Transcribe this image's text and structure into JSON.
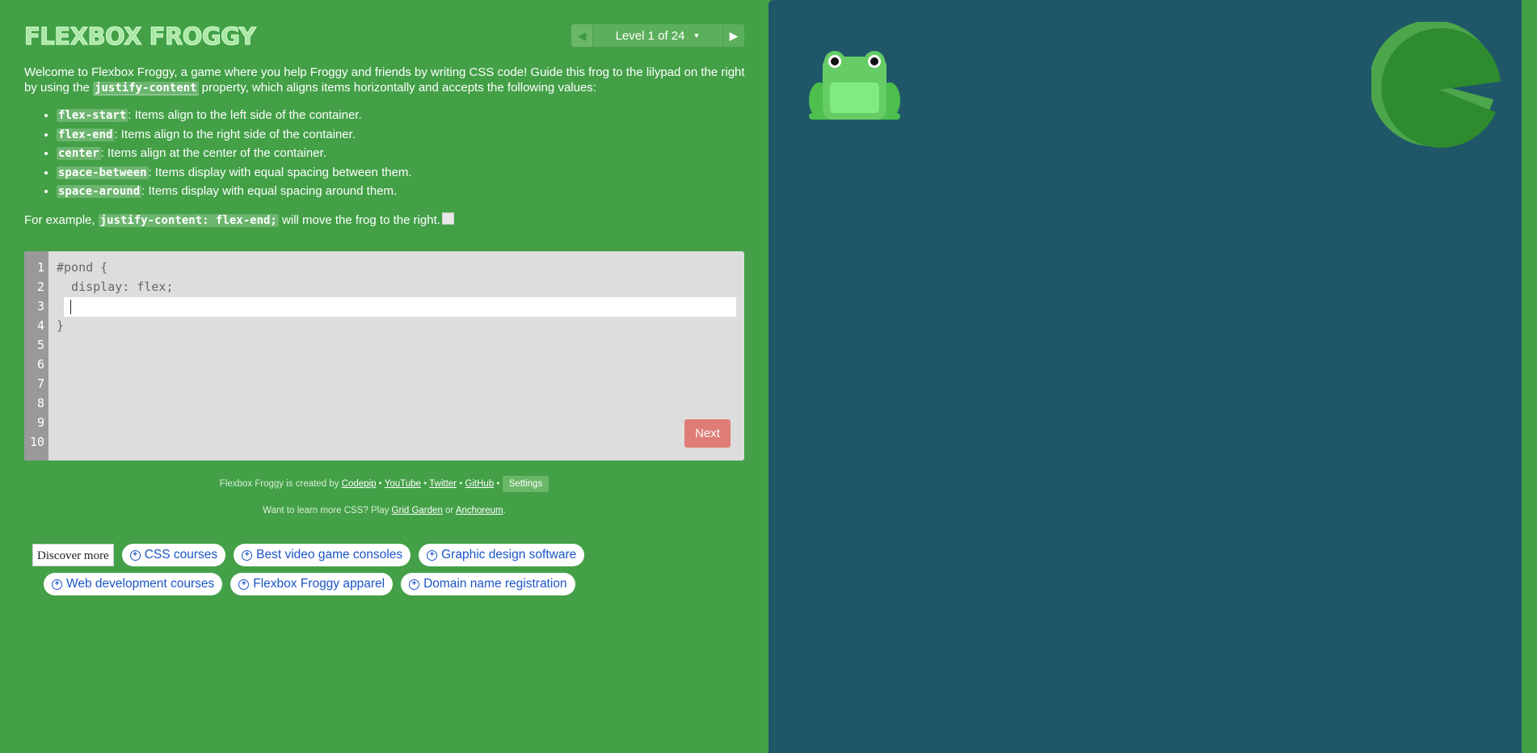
{
  "game": {
    "title": "Flexbox Froggy",
    "level": {
      "prev_icon": "triangle-left-icon",
      "label": "Level 1 of 24",
      "dropdown_icon": "caret-down-icon",
      "next_icon": "triangle-right-icon"
    }
  },
  "instructions": {
    "intro_part1": "Welcome to Flexbox Froggy, a game where you help Froggy and friends by writing CSS code! Guide this frog to the lilypad on the right by using the ",
    "intro_property": "justify-content",
    "intro_part2": " property, which aligns items horizontally and accepts the following values:",
    "values": [
      {
        "code": "flex-start",
        "description": ": Items align to the left side of the container."
      },
      {
        "code": "flex-end",
        "description": ": Items align to the right side of the container."
      },
      {
        "code": "center",
        "description": ": Items align at the center of the container."
      },
      {
        "code": "space-between",
        "description": ": Items display with equal spacing between them."
      },
      {
        "code": "space-around",
        "description": ": Items display with equal spacing around them."
      }
    ],
    "example_prefix": "For example, ",
    "example_code": "justify-content: flex-end;",
    "example_suffix": " will move the frog to the right."
  },
  "editor": {
    "line_numbers": [
      "1",
      "2",
      "3",
      "4",
      "5",
      "6",
      "7",
      "8",
      "9",
      "10"
    ],
    "line1": "#pond {",
    "line2": "  display: flex;",
    "input_value": "",
    "line4": "}",
    "next_label": "Next"
  },
  "footer": {
    "created_by": "Flexbox Froggy is created by ",
    "codepip": "Codepip",
    "sep": " • ",
    "youtube": "YouTube",
    "twitter": "Twitter",
    "github": "GitHub",
    "settings": "Settings",
    "learn_prefix": "Want to learn more CSS? Play ",
    "grid_garden": "Grid Garden",
    "or": " or ",
    "anchoreum": "Anchoreum",
    "period": "."
  },
  "discover": {
    "label": "Discover more",
    "row1": [
      "CSS courses",
      "Best video game consoles",
      "Graphic design software"
    ],
    "row2": [
      "Web development courses",
      "Flexbox Froggy apparel",
      "Domain name registration"
    ]
  },
  "colors": {
    "left_bg": "#43a047",
    "pond_bg": "#1f5768",
    "frog": "#66cc66",
    "lilypad": "#2e8b2e",
    "next_button": "#e0726b"
  }
}
